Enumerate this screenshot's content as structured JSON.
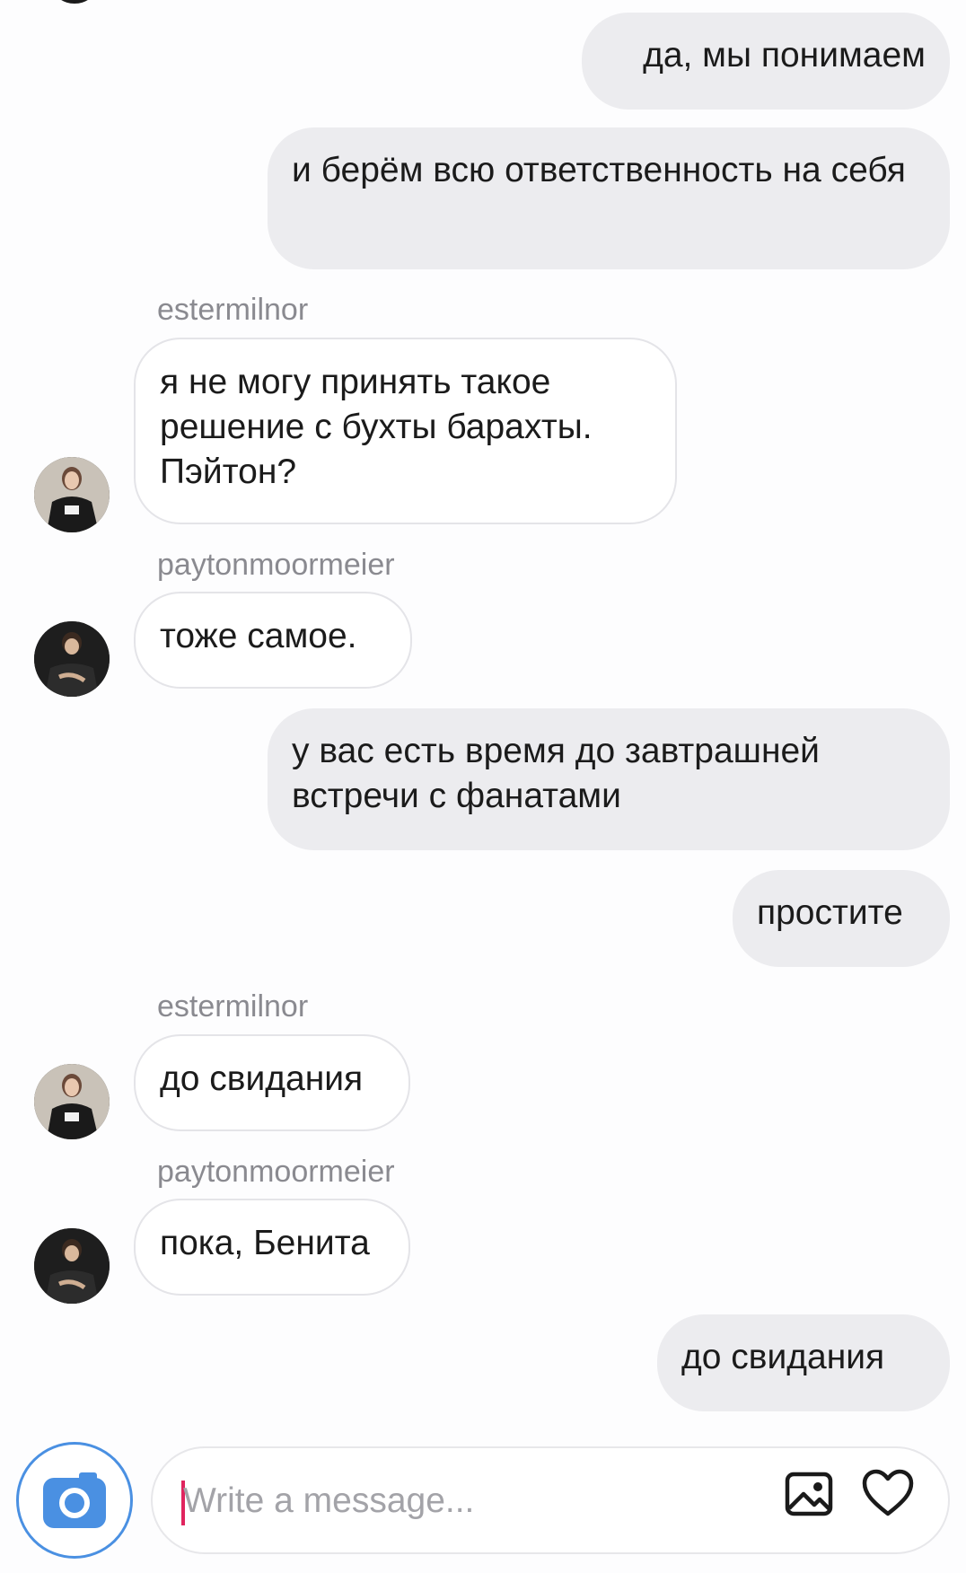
{
  "messages": [
    {
      "side": "me",
      "text": "да, мы понимаем"
    },
    {
      "side": "me",
      "text": "и берём всю ответственность на себя"
    },
    {
      "side": "them",
      "user": "estermilnor",
      "text": "я не могу принять такое решение с бухты барахты. Пэйтон?"
    },
    {
      "side": "them",
      "user": "paytonmoormeier",
      "text": "тоже самое."
    },
    {
      "side": "me",
      "text": "у вас есть время до завтрашней встречи с фанатами"
    },
    {
      "side": "me",
      "text": "простите"
    },
    {
      "side": "them",
      "user": "estermilnor",
      "text": "до свидания"
    },
    {
      "side": "them",
      "user": "paytonmoormeier",
      "text": "пока, Бенита"
    },
    {
      "side": "me",
      "text": "до свидания"
    }
  ],
  "composer": {
    "placeholder": "Write a message...",
    "camera_icon": "camera-icon",
    "gallery_icon": "gallery-icon",
    "like_icon": "heart-icon"
  },
  "colors": {
    "my_bubble": "#ececef",
    "their_bubble_border": "#e4e4e8",
    "accent": "#4a90e2",
    "caret": "#e0245e"
  }
}
